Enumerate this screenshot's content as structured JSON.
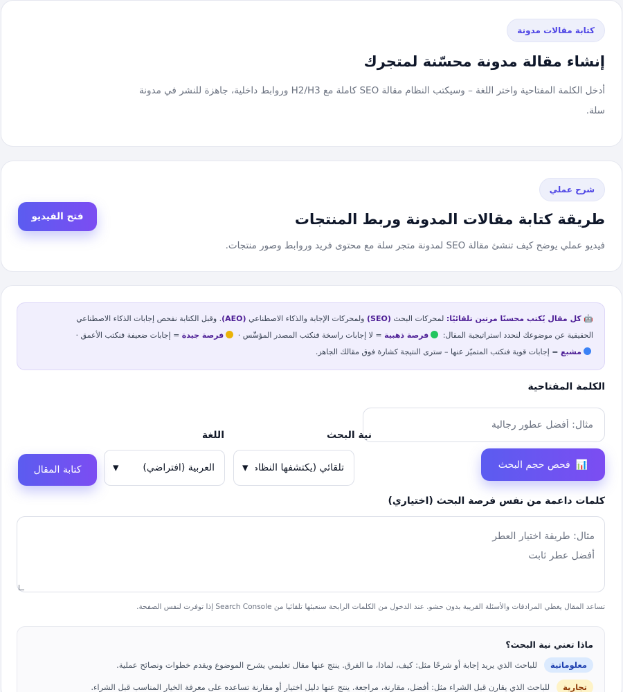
{
  "card1": {
    "pill": "كتابة مقالات مدونة",
    "title": "إنشاء مقالة مدونة محسّنة لمتجرك",
    "desc_line1": "أدخل الكلمة المفتاحية واختر اللغة – وسيكتب النظام مقالة SEO كاملة مع H2/H3 وروابط داخلية، جاهزة للنشر في مدونة",
    "desc_line2": "سلة."
  },
  "card2": {
    "pill": "شرح عملي",
    "title": "طريقة كتابة مقالات المدونة وربط المنتجات",
    "desc": "فيديو عملي يوضح كيف تنشئ مقالة SEO لمدونة متجر سلة مع محتوى فريد وروابط وصور منتجات.",
    "button": "فتح الفيديو"
  },
  "info": {
    "icon": "🤖",
    "lead_bold": "كل مقال يُكتب محسنًا مرتين تلقائيًا:",
    "lead_text": " لمحركات البحث ",
    "seo": "(SEO)",
    "mid_text": " ولمحركات الإجابة والذكاء الاصطناعي ",
    "aeo": "(AEO)",
    "line1_tail": ". وقبل الكتابة نفحص إجابات الذكاء الاصطناعي",
    "line2_start": "الحقيقية عن موضوعك لنحدد استراتيجية المقال:",
    "gold_label": "فرصة ذهبية",
    "gold_text": " = لا إجابات راسخة فنكتب المصدر المؤسِّس ·",
    "good_label": "فرصة جيدة",
    "good_text": " = إجابات ضعيفة فنكتب الأعمق ·",
    "sat_label": "مشبع",
    "sat_text": " = إجابات قوية فنكتب المتميّز عنها – سترى النتيجة كشارة فوق مقالك الجاهز.",
    "colors": {
      "green": "#22c55e",
      "gold": "#eab308",
      "blue": "#3b82f6"
    }
  },
  "form": {
    "keyword_label": "الكلمة المفتاحية",
    "keyword_placeholder": "مثال: أفضل عطور رجالية",
    "volume_button": "فحص حجم البحث",
    "volume_icon": "📊",
    "intent_label": "نية البحث",
    "intent_value": "تلقائي (يكتشفها النظام)",
    "language_label": "اللغة",
    "language_value": "العربية (افتراضي)",
    "write_button": "كتابة المقال",
    "supporting_label": "كلمات داعمة من نفس فرصة البحث (اختياري)",
    "supporting_line1": "مثال: طريقة اختيار العطر",
    "supporting_line2": "أفضل عطر ثابت",
    "help": "تساعد المقال يغطي المرادفات والأسئلة القريبة بدون حشو. عند الدخول من الكلمات الرابحة سنعبئها تلقائيا من Search Console إذا توفرت لنفس الصفحة."
  },
  "intent_help": {
    "title": "ماذا تعني نية البحث؟",
    "rows": [
      {
        "badge": "معلوماتية",
        "text": "للباحث الذي يريد إجابة أو شرحًا مثل: كيف، لماذا، ما الفرق. ينتج عنها مقال تعليمي يشرح الموضوع ويقدم خطوات ونصائح عملية.",
        "bg": "#dbeafe",
        "fg": "#1e40af"
      },
      {
        "badge": "تجارية",
        "text": "للباحث الذي يقارن قبل الشراء مثل: أفضل، مقارنة، مراجعة. ينتج عنها دليل اختيار أو مقارنة تساعده على معرفة الخيار المناسب قبل الشراء.",
        "bg": "#fef3c7",
        "fg": "#92400e"
      }
    ]
  }
}
